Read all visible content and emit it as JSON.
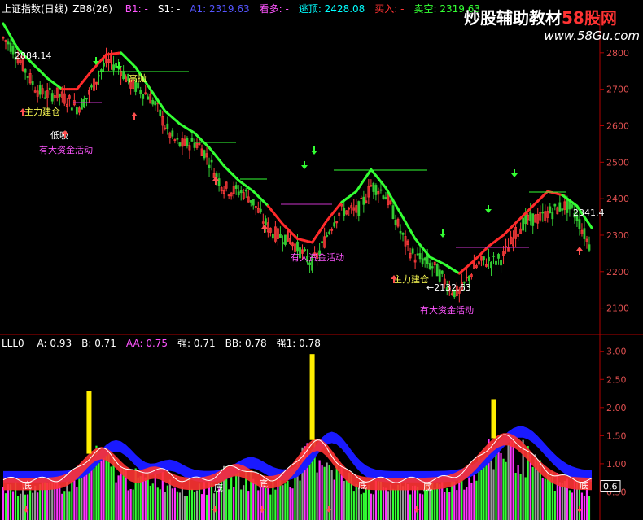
{
  "header": {
    "title": "上证指数(日线)",
    "indicator": "ZB8(26)",
    "fields": [
      {
        "label": "B1:",
        "value": "-",
        "color": "#ff55ff"
      },
      {
        "label": "S1:",
        "value": "-",
        "color": "#ffffff"
      },
      {
        "label": "A1:",
        "value": "2319.63",
        "color": "#5555ff"
      },
      {
        "label": "看多:",
        "value": "-",
        "color": "#ff55ff"
      },
      {
        "label": "逃顶:",
        "value": "2428.08",
        "color": "#00ffff"
      },
      {
        "label": "买入:",
        "value": "-",
        "color": "#ff3333"
      },
      {
        "label": "卖空:",
        "value": "2319.63",
        "color": "#33ff33"
      }
    ]
  },
  "watermark": {
    "text": "炒股辅助教材",
    "brand": "58股网",
    "url": "www.58Gu.com"
  },
  "sub_header": {
    "label": "LLL0",
    "fields": [
      {
        "label": "A:",
        "value": "0.93",
        "color": "#ffffff"
      },
      {
        "label": "B:",
        "value": "0.71",
        "color": "#ffffff"
      },
      {
        "label": "AA:",
        "value": "0.75",
        "color": "#ff55ff"
      },
      {
        "label": "强:",
        "value": "0.71",
        "color": "#ffffff"
      },
      {
        "label": "BB:",
        "value": "0.78",
        "color": "#ffffff"
      },
      {
        "label": "强1:",
        "value": "0.78",
        "color": "#ffffff"
      }
    ]
  },
  "chart_data": [
    {
      "type": "line",
      "panel": "main",
      "y_ticks": [
        2100,
        2200,
        2300,
        2400,
        2500,
        2600,
        2700,
        2800
      ],
      "ylim": [
        2030,
        2900
      ],
      "grid": false,
      "price_labels": [
        "2884.14",
        "2132.63",
        "2341.4"
      ],
      "ma_line": {
        "x": [
          0,
          6,
          12,
          18,
          24,
          30,
          36,
          42,
          48,
          54,
          60,
          66,
          72,
          78,
          84,
          90,
          96,
          102,
          108,
          114,
          120,
          126,
          132,
          138,
          144,
          150,
          156,
          162,
          168,
          174,
          180,
          186,
          192,
          198,
          204,
          210,
          216,
          222,
          228,
          234,
          240
        ],
        "values": [
          2880,
          2810,
          2770,
          2730,
          2700,
          2700,
          2750,
          2795,
          2800,
          2760,
          2700,
          2640,
          2605,
          2580,
          2540,
          2490,
          2450,
          2420,
          2380,
          2330,
          2290,
          2280,
          2340,
          2390,
          2420,
          2480,
          2430,
          2360,
          2290,
          2240,
          2220,
          2195,
          2230,
          2270,
          2300,
          2340,
          2380,
          2420,
          2410,
          2380,
          2320
        ],
        "red_x_ranges": [
          [
            24,
            48
          ],
          [
            108,
            138
          ],
          [
            186,
            228
          ]
        ]
      },
      "annotations": [
        "主力建仓",
        "低吸",
        "有大资金活动",
        "高抛",
        "主力建仓",
        "有大资金活动",
        "有大资金活动"
      ]
    },
    {
      "type": "bar",
      "panel": "sub",
      "y_ticks": [
        0.5,
        1.0,
        1.5,
        2.0,
        2.5,
        3.0
      ],
      "ylim": [
        0.0,
        3.3
      ],
      "current_value": "0.6",
      "annotations": [
        "底"
      ]
    }
  ]
}
